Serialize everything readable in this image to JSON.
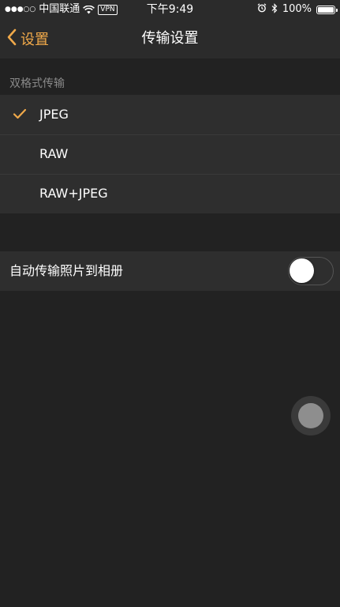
{
  "status_bar": {
    "signal_dots": "●●●○○",
    "carrier": "中国联通",
    "vpn": "VPN",
    "time": "下午9:49",
    "battery_text": "100%",
    "battery_level": 1.0
  },
  "nav": {
    "back_label": "设置",
    "title": "传输设置"
  },
  "dual_format": {
    "header": "双格式传输",
    "selected": "JPEG",
    "options": [
      {
        "label": "JPEG",
        "checked": true
      },
      {
        "label": "RAW",
        "checked": false
      },
      {
        "label": "RAW+JPEG",
        "checked": false
      }
    ]
  },
  "auto_transfer": {
    "label": "自动传输照片到相册",
    "enabled": false
  },
  "colors": {
    "accent": "#f0a94a",
    "background": "#222222",
    "row_background": "#2e2e2e",
    "section_header": "#8a8a8a"
  }
}
